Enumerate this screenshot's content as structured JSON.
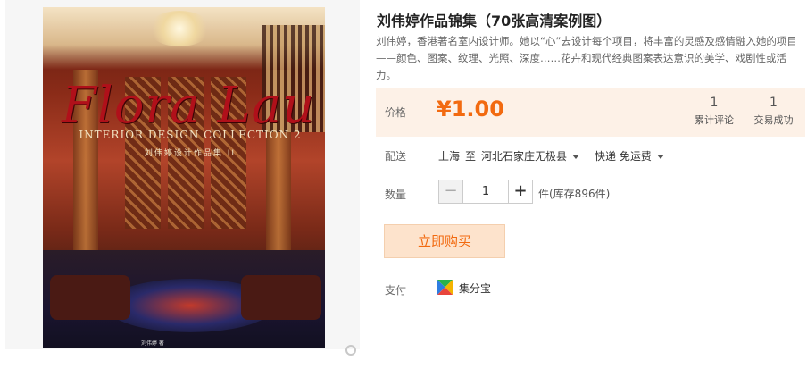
{
  "product": {
    "title": "刘伟婷作品锦集（70张高清案例图）",
    "description": "刘伟婷，香港著名室内设计师。她以“心”去设计每个项目，将丰富的灵感及感情融入她的项目——颜色、图案、纹理、光照、深度……花卉和现代经典图案表达意识的美学、戏剧性或活力。"
  },
  "cover": {
    "title_script": "Flora Lau",
    "title_subtitle": "INTERIOR DESIGN COLLECTION 2",
    "title_cn": "刘伟婷设计作品集 II",
    "bottom_text": "刘伟婷 著"
  },
  "price": {
    "label": "价格",
    "value": "¥1.00",
    "stats": {
      "review_count": "1",
      "review_label": "累计评论",
      "success_count": "1",
      "success_label": "交易成功"
    }
  },
  "shipping": {
    "label": "配送",
    "from": "上海",
    "to_word": "至",
    "destination": "河北石家庄无极县",
    "method": "快递 免运费"
  },
  "quantity": {
    "label": "数量",
    "minus": "−",
    "value": "1",
    "plus": "+",
    "stock": "件(库存896件)"
  },
  "buy_label": "立即购买",
  "payment": {
    "label": "支付",
    "method": "集分宝"
  },
  "colors": {
    "accent": "#f26a10",
    "price_bg": "#fdf1e7",
    "buy_bg": "#fde3cc"
  }
}
